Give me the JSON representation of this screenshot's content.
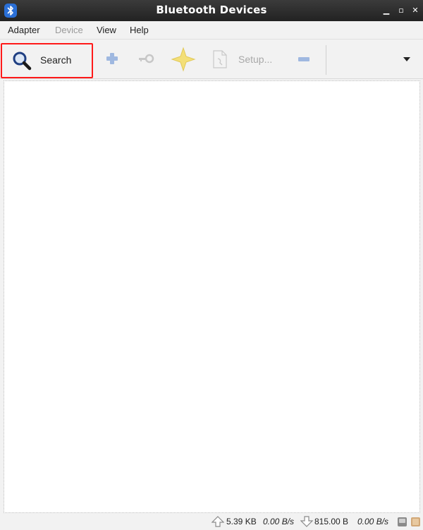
{
  "window": {
    "title": "Bluetooth Devices",
    "minimize_glyph": "▁",
    "maximize_glyph": "▫",
    "close_glyph": "✕",
    "app_icon": "bluetooth-icon"
  },
  "menubar": {
    "items": [
      {
        "label": "Adapter",
        "enabled": true
      },
      {
        "label": "Device",
        "enabled": false
      },
      {
        "label": "View",
        "enabled": true
      },
      {
        "label": "Help",
        "enabled": true
      }
    ]
  },
  "toolbar": {
    "search": {
      "label": "Search",
      "icon": "magnifier-icon"
    },
    "add": {
      "icon": "plus-icon"
    },
    "pair": {
      "icon": "key-icon"
    },
    "trust": {
      "icon": "star-icon"
    },
    "setup": {
      "label": "Setup...",
      "icon": "document-icon"
    },
    "remove": {
      "icon": "minus-icon"
    },
    "overflow": {
      "icon": "chevron-down-icon"
    }
  },
  "statusbar": {
    "upload_total": "5.39 KB",
    "upload_rate": "0.00 B/s",
    "download_total": "815.00 B",
    "download_rate": "0.00 B/s"
  },
  "colors": {
    "highlight_border": "#ff1a1a",
    "titlebar": "#2d2d2d",
    "disabled_text": "#9a9a9a"
  }
}
